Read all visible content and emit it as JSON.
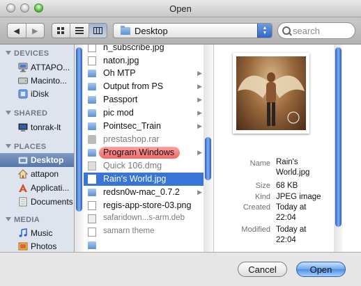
{
  "window": {
    "title": "Open"
  },
  "toolbar": {
    "back_icon": "back-arrow-icon",
    "forward_icon": "forward-arrow-icon",
    "location": "Desktop",
    "search_placeholder": "search"
  },
  "sidebar": {
    "devices_title": "DEVICES",
    "devices": [
      {
        "label": "ATTAPO...",
        "icon": "computer-icon"
      },
      {
        "label": "Macinto...",
        "icon": "hard-disk-icon"
      },
      {
        "label": "iDisk",
        "icon": "idisk-icon"
      }
    ],
    "shared_title": "SHARED",
    "shared": [
      {
        "label": "tonrak-lt",
        "icon": "network-computer-icon"
      }
    ],
    "places_title": "PLACES",
    "places": [
      {
        "label": "Desktop",
        "icon": "desktop-folder-icon",
        "selected": true
      },
      {
        "label": "attapon",
        "icon": "home-icon"
      },
      {
        "label": "Applicati...",
        "icon": "applications-icon"
      },
      {
        "label": "Documents",
        "icon": "documents-icon"
      }
    ],
    "media_title": "MEDIA",
    "media": [
      {
        "label": "Music",
        "icon": "music-icon"
      },
      {
        "label": "Photos",
        "icon": "photos-icon"
      }
    ]
  },
  "files": [
    {
      "name": "n_subscribe.jpg",
      "kind": "doc"
    },
    {
      "name": "naton.jpg",
      "kind": "doc"
    },
    {
      "name": "Oh MTP",
      "kind": "folder"
    },
    {
      "name": "Output from PS",
      "kind": "folder"
    },
    {
      "name": "Passport",
      "kind": "folder"
    },
    {
      "name": "pic mod",
      "kind": "folder"
    },
    {
      "name": "Pointsec_Train",
      "kind": "folder"
    },
    {
      "name": "prestashop.rar",
      "kind": "archive"
    },
    {
      "name": "Program Windows",
      "kind": "folder-labeled"
    },
    {
      "name": "Quick 106.dmg",
      "kind": "dmg"
    },
    {
      "name": "Rain's World.jpg",
      "kind": "doc",
      "selected": true
    },
    {
      "name": "redsn0w-mac_0.7.2",
      "kind": "folder"
    },
    {
      "name": "regis-app-store-03.png",
      "kind": "doc"
    },
    {
      "name": "safaridown...s-arm.deb",
      "kind": "deb"
    },
    {
      "name": "samarn theme",
      "kind": "doc"
    },
    {
      "name": "",
      "kind": "folder"
    }
  ],
  "preview": {
    "name_key": "Name",
    "name_val_1": "Rain's",
    "name_val_2": "World.jpg",
    "size_key": "Size",
    "size_val": "68 KB",
    "kind_key": "Kind",
    "kind_val": "JPEG image",
    "created_key": "Created",
    "created_val_1": "Today at",
    "created_val_2": "22:04",
    "modified_key": "Modified",
    "modified_val_1": "Today at",
    "modified_val_2": "22:04"
  },
  "buttons": {
    "cancel": "Cancel",
    "open": "Open"
  }
}
